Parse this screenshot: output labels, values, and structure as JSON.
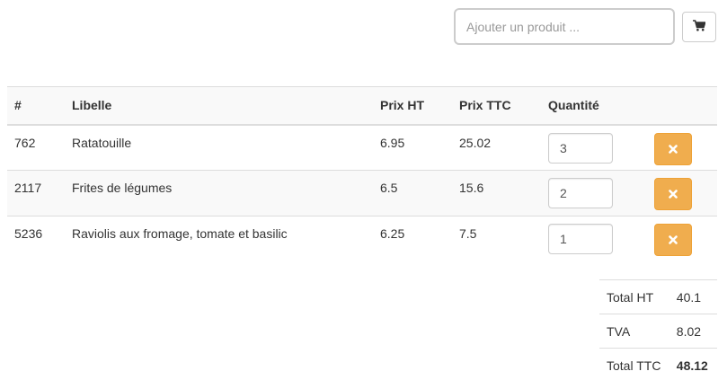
{
  "search": {
    "placeholder": "Ajouter un produit ..."
  },
  "cart_button": {
    "icon": "shopping-cart-icon"
  },
  "table": {
    "headers": {
      "id": "#",
      "label": "Libelle",
      "price_ht": "Prix HT",
      "price_ttc": "Prix TTC",
      "quantity": "Quantité"
    },
    "rows": [
      {
        "id": "762",
        "label": "Ratatouille",
        "price_ht": "6.95",
        "price_ttc": "25.02",
        "quantity": "3"
      },
      {
        "id": "2117",
        "label": "Frites de légumes",
        "price_ht": "6.5",
        "price_ttc": "15.6",
        "quantity": "2"
      },
      {
        "id": "5236",
        "label": "Raviolis aux fromage, tomate et basilic",
        "price_ht": "6.25",
        "price_ttc": "7.5",
        "quantity": "1"
      }
    ],
    "delete_icon": "times-icon",
    "delete_color": "#f0ad4e"
  },
  "totals": {
    "ht_label": "Total HT",
    "ht_value": "40.1",
    "tva_label": "TVA",
    "tva_value": "8.02",
    "ttc_label": "Total TTC",
    "ttc_value": "48.12"
  }
}
